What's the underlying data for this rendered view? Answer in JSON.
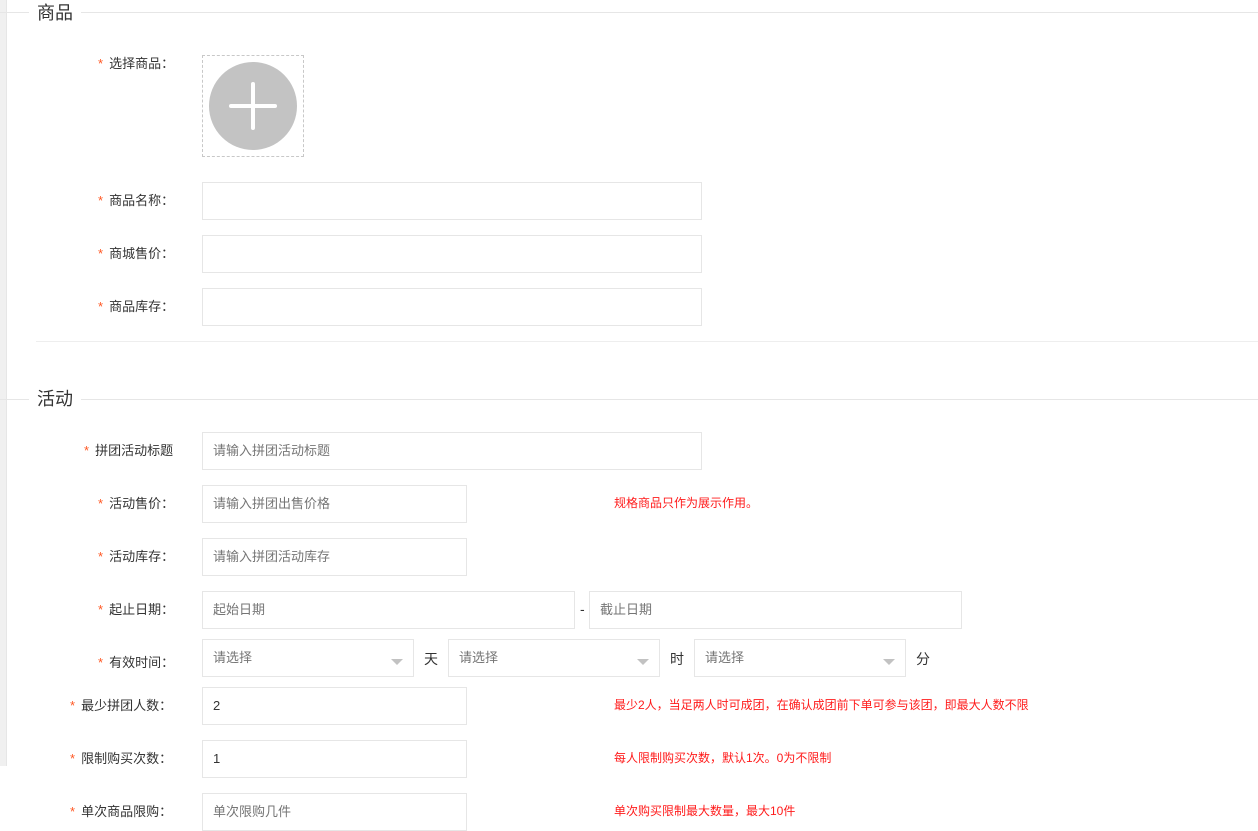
{
  "product_section": {
    "legend": "商品",
    "fields": {
      "select_product": "选择商品：",
      "product_name": "商品名称：",
      "mall_price": "商城售价：",
      "product_stock": "商品库存："
    },
    "values": {
      "product_name": "",
      "mall_price": "",
      "product_stock": ""
    }
  },
  "activity_section": {
    "legend": "活动",
    "fields": {
      "group_title": {
        "label": "拼团活动标题",
        "placeholder": "请输入拼团活动标题",
        "value": ""
      },
      "activity_price": {
        "label": "活动售价：",
        "placeholder": "请输入拼团出售价格",
        "value": "",
        "tip": "规格商品只作为展示作用。"
      },
      "activity_stock": {
        "label": "活动库存：",
        "placeholder": "请输入拼团活动库存",
        "value": ""
      },
      "date_range": {
        "label": "起止日期：",
        "start_placeholder": "起始日期",
        "end_placeholder": "截止日期",
        "separator": "-"
      },
      "valid_time": {
        "label": "有效时间：",
        "day_placeholder": "请选择",
        "day_unit": "天",
        "hour_placeholder": "请选择",
        "hour_unit": "时",
        "minute_placeholder": "请选择",
        "minute_unit": "分"
      },
      "min_people": {
        "label": "最少拼团人数：",
        "value": "2",
        "tip": "最少2人，当足两人时可成团，在确认成团前下单可参与该团，即最大人数不限"
      },
      "purchase_limit": {
        "label": "限制购买次数：",
        "value": "1",
        "tip": "每人限制购买次数，默认1次。0为不限制"
      },
      "single_limit": {
        "label": "单次商品限购：",
        "placeholder": "单次限购几件",
        "value": "",
        "tip": "单次购买限制最大数量，最大10件"
      }
    }
  },
  "required_mark": "*",
  "colors": {
    "required": "#ff5722",
    "tip": "#ff1b1b",
    "border": "#e6e6e6",
    "upload_icon": "#c3c3c3"
  }
}
